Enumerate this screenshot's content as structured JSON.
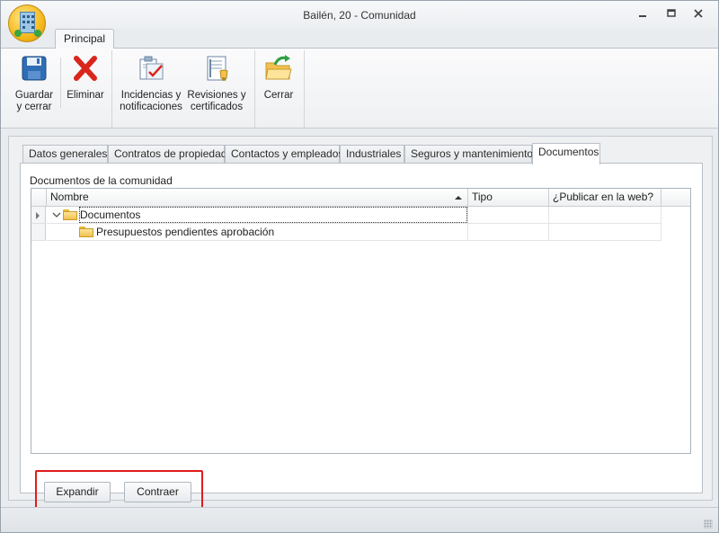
{
  "window": {
    "title": "Bailén, 20 - Comunidad",
    "controls": [
      "minimize",
      "restore",
      "close"
    ]
  },
  "ribbon": {
    "tab": "Principal",
    "buttons": {
      "save_close": [
        "Guardar",
        "y cerrar"
      ],
      "delete": [
        "Eliminar"
      ],
      "incidents": [
        "Incidencias y",
        "notificaciones"
      ],
      "revisions": [
        "Revisiones y",
        "certificados"
      ],
      "close": [
        "Cerrar"
      ]
    }
  },
  "tabs": [
    "Datos generales",
    "Contratos de propiedad",
    "Contactos y empleados",
    "Industriales",
    "Seguros y mantenimientos",
    "Documentos"
  ],
  "active_tab": "Documentos",
  "documents": {
    "section_label": "Documentos de la comunidad",
    "columns": [
      "Nombre",
      "Tipo",
      "¿Publicar en la web?"
    ],
    "sort": {
      "column": "Nombre",
      "direction": "ascending"
    },
    "rows": [
      {
        "name": "Documentos",
        "tipo": "",
        "publicar": "",
        "level": 0,
        "expanded": true,
        "focused": true
      },
      {
        "name": "Presupuestos pendientes aprobación",
        "tipo": "",
        "publicar": "",
        "level": 1,
        "expanded": false,
        "focused": false
      }
    ],
    "buttons": {
      "expand": "Expandir",
      "collapse": "Contraer"
    }
  },
  "colors": {
    "highlight_border": "#e01c1c",
    "folder": "#f2c14e",
    "delete_x": "#d9261c"
  }
}
